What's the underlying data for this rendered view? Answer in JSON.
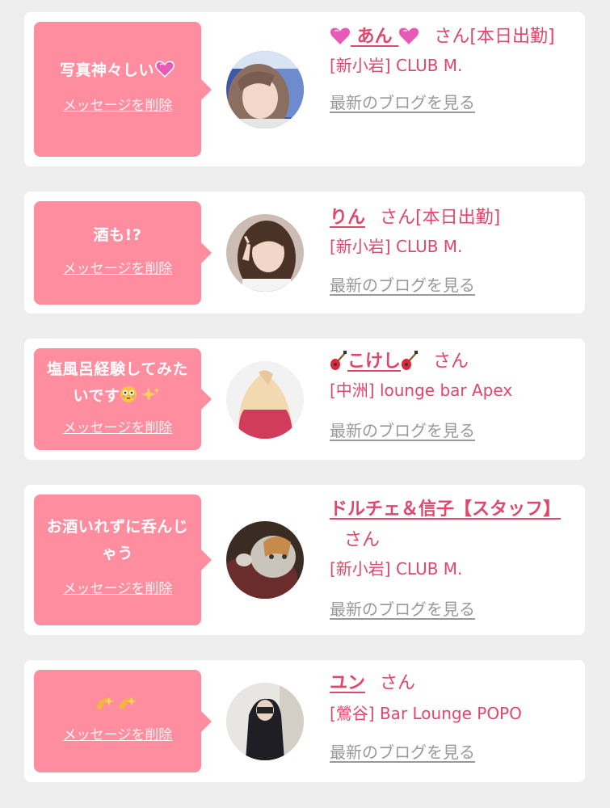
{
  "colors": {
    "bubble": "#fe8e9f",
    "accent": "#e0476b",
    "muted": "#999999",
    "background": "#eeeeee"
  },
  "delete_label": "メッセージを削除",
  "blog_label": "最新のブログを見る",
  "san": "さん",
  "items": [
    {
      "message": "写真神々しい",
      "message_emoji": "purple-heart-icon",
      "name": "あん",
      "name_decor": "purple-heart-icon",
      "status": "[本日出勤]",
      "shop": "[新小岩] CLUB M."
    },
    {
      "message": "酒も!?",
      "name": "りん",
      "status": "[本日出勤]",
      "shop": "[新小岩] CLUB M."
    },
    {
      "message": "塩風呂経験してみたいです",
      "message_emoji": "flushed-face-and-sparkles-icon",
      "name": "こけし",
      "name_decor": "guitar-icon",
      "shop": "[中洲] lounge bar Apex"
    },
    {
      "message": "お酒いれずに呑んじゃう",
      "name": "ドルチェ＆信子【スタッフ】",
      "shop": "[新小岩] CLUB M."
    },
    {
      "message": "",
      "message_emoji": "dizzy-icon",
      "name": "ユン",
      "shop": "[鶯谷] Bar Lounge POPO"
    }
  ]
}
